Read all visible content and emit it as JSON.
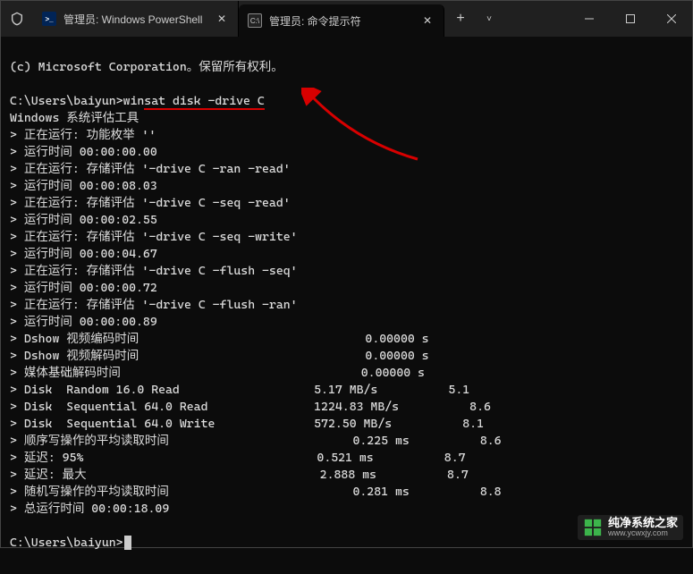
{
  "titlebar": {
    "tabs": [
      {
        "icon": "powershell",
        "title": "管理员: Windows PowerShell",
        "active": false
      },
      {
        "icon": "cmd",
        "title": "管理员: 命令提示符",
        "active": true
      }
    ],
    "new_tab": "+",
    "chevron": "˅"
  },
  "terminal": {
    "copyright": "(c) Microsoft Corporation。保留所有权利。",
    "prompt1_prefix": "C:\\Users\\baiyun>",
    "prompt1_cmd_plain": "win",
    "prompt1_cmd_underlined": "sat disk -drive C",
    "header": "Windows 系统评估工具",
    "lines": [
      "> 正在运行: 功能枚举 ''",
      "> 运行时间 00:00:00.00",
      "> 正在运行: 存储评估 '-drive C -ran -read'",
      "> 运行时间 00:00:08.03",
      "> 正在运行: 存储评估 '-drive C -seq -read'",
      "> 运行时间 00:00:02.55",
      "> 正在运行: 存储评估 '-drive C -seq -write'",
      "> 运行时间 00:00:04.67",
      "> 正在运行: 存储评估 '-drive C -flush -seq'",
      "> 运行时间 00:00:00.72",
      "> 正在运行: 存储评估 '-drive C -flush -ran'",
      "> 运行时间 00:00:00.89",
      "> Dshow 视频编码时间                                0.00000 s",
      "> Dshow 视频解码时间                                0.00000 s",
      "> 媒体基础解码时间                                  0.00000 s",
      "> Disk  Random 16.0 Read                   5.17 MB/s          5.1",
      "> Disk  Sequential 64.0 Read               1224.83 MB/s          8.6",
      "> Disk  Sequential 64.0 Write              572.50 MB/s          8.1",
      "> 顺序写操作的平均读取时间                          0.225 ms          8.6",
      "> 延迟: 95%                                 0.521 ms          8.7",
      "> 延迟: 最大                                 2.888 ms          8.7",
      "> 随机写操作的平均读取时间                          0.281 ms          8.8",
      "> 总运行时间 00:00:18.09"
    ],
    "prompt2": "C:\\Users\\baiyun>"
  },
  "watermark": {
    "title": "纯净系统之家",
    "url": "www.ycwxjy.com"
  }
}
